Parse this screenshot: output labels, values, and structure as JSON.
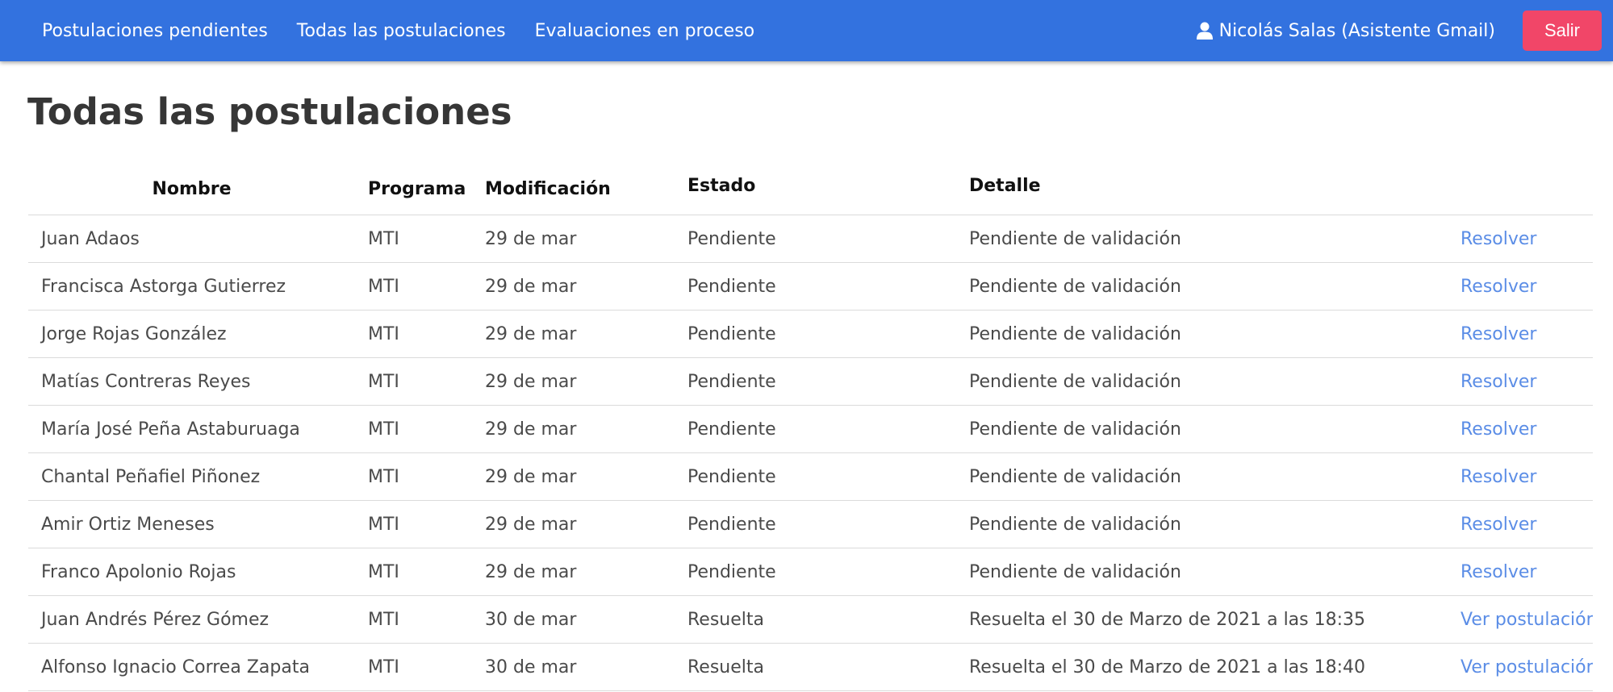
{
  "navbar": {
    "links": [
      "Postulaciones pendientes",
      "Todas las postulaciones",
      "Evaluaciones en proceso"
    ],
    "user_icon": "user-icon",
    "user_label": "Nicolás Salas (Asistente Gmail)",
    "logout_label": "Salir",
    "colors": {
      "bar": "#3372df",
      "logout": "#f14668"
    }
  },
  "page": {
    "title": "Todas las postulaciones"
  },
  "table": {
    "headers": {
      "nombre": "Nombre",
      "programa": "Programa",
      "modificacion": "Modificación",
      "estado": "Estado",
      "detalle": "Detalle"
    },
    "rows": [
      {
        "nombre": "Juan Adaos",
        "programa": "MTI",
        "modificacion": "29 de mar",
        "estado": "Pendiente",
        "detalle": "Pendiente de validación",
        "accion": "Resolver"
      },
      {
        "nombre": "Francisca Astorga Gutierrez",
        "programa": "MTI",
        "modificacion": "29 de mar",
        "estado": "Pendiente",
        "detalle": "Pendiente de validación",
        "accion": "Resolver"
      },
      {
        "nombre": "Jorge Rojas González",
        "programa": "MTI",
        "modificacion": "29 de mar",
        "estado": "Pendiente",
        "detalle": "Pendiente de validación",
        "accion": "Resolver"
      },
      {
        "nombre": "Matías Contreras Reyes",
        "programa": "MTI",
        "modificacion": "29 de mar",
        "estado": "Pendiente",
        "detalle": "Pendiente de validación",
        "accion": "Resolver"
      },
      {
        "nombre": "María José Peña Astaburuaga",
        "programa": "MTI",
        "modificacion": "29 de mar",
        "estado": "Pendiente",
        "detalle": "Pendiente de validación",
        "accion": "Resolver"
      },
      {
        "nombre": "Chantal Peñafiel Piñonez",
        "programa": "MTI",
        "modificacion": "29 de mar",
        "estado": "Pendiente",
        "detalle": "Pendiente de validación",
        "accion": "Resolver"
      },
      {
        "nombre": "Amir Ortiz Meneses",
        "programa": "MTI",
        "modificacion": "29 de mar",
        "estado": "Pendiente",
        "detalle": "Pendiente de validación",
        "accion": "Resolver"
      },
      {
        "nombre": "Franco Apolonio Rojas",
        "programa": "MTI",
        "modificacion": "29 de mar",
        "estado": "Pendiente",
        "detalle": "Pendiente de validación",
        "accion": "Resolver"
      },
      {
        "nombre": "Juan Andrés Pérez Gómez",
        "programa": "MTI",
        "modificacion": "30 de mar",
        "estado": "Resuelta",
        "detalle": "Resuelta el 30 de Marzo de 2021 a las 18:35",
        "accion": "Ver postulación"
      },
      {
        "nombre": "Alfonso Ignacio Correa Zapata",
        "programa": "MTI",
        "modificacion": "30 de mar",
        "estado": "Resuelta",
        "detalle": "Resuelta el 30 de Marzo de 2021 a las 18:40",
        "accion": "Ver postulación"
      }
    ]
  }
}
